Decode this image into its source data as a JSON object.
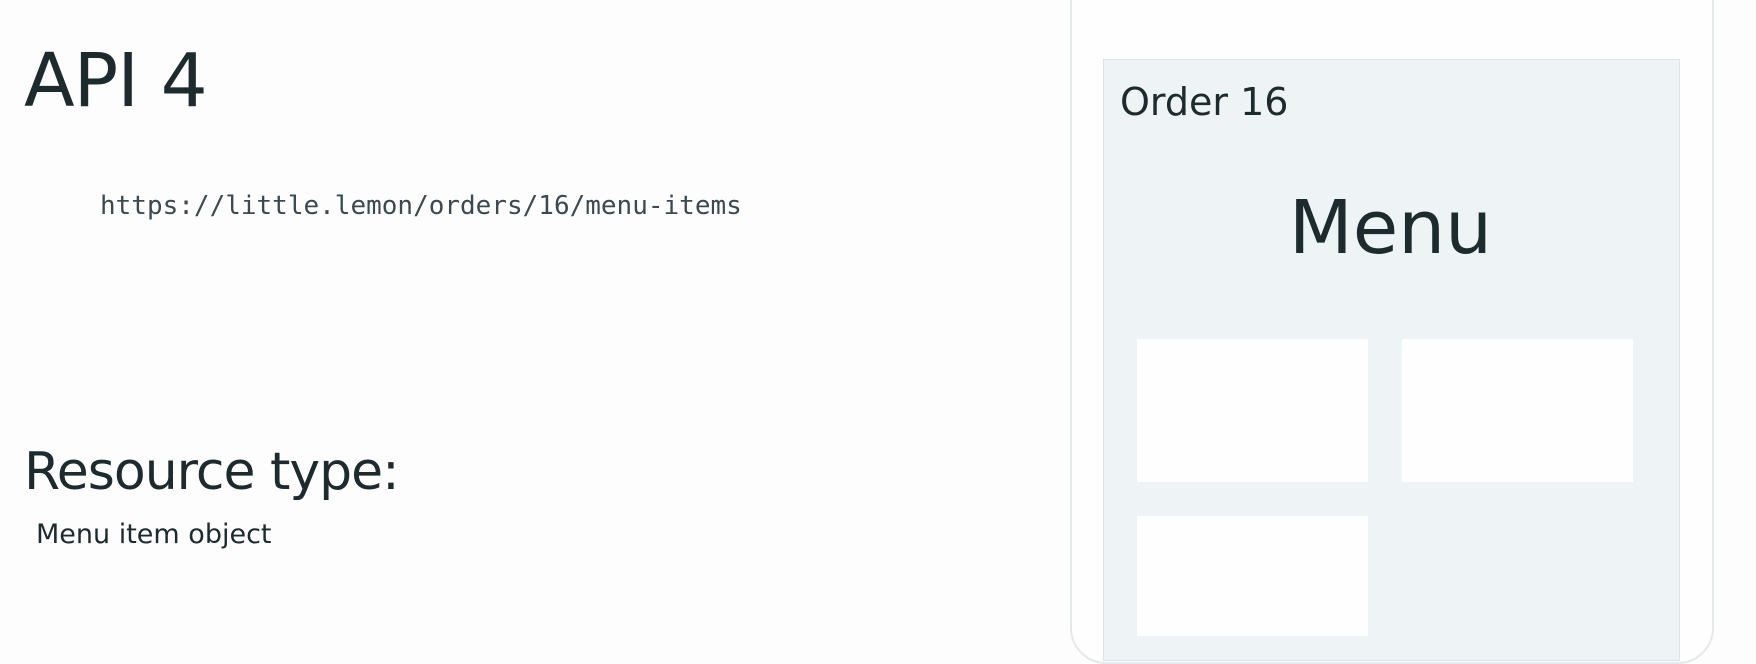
{
  "slide": {
    "title": "API 4",
    "url": "https://little.lemon/orders/16/menu-items",
    "resource_label": "Resource type:",
    "resource_value": "Menu item object"
  },
  "phone": {
    "order_label": "Order 16",
    "heading": "Menu",
    "cards": [
      "",
      "",
      ""
    ]
  }
}
